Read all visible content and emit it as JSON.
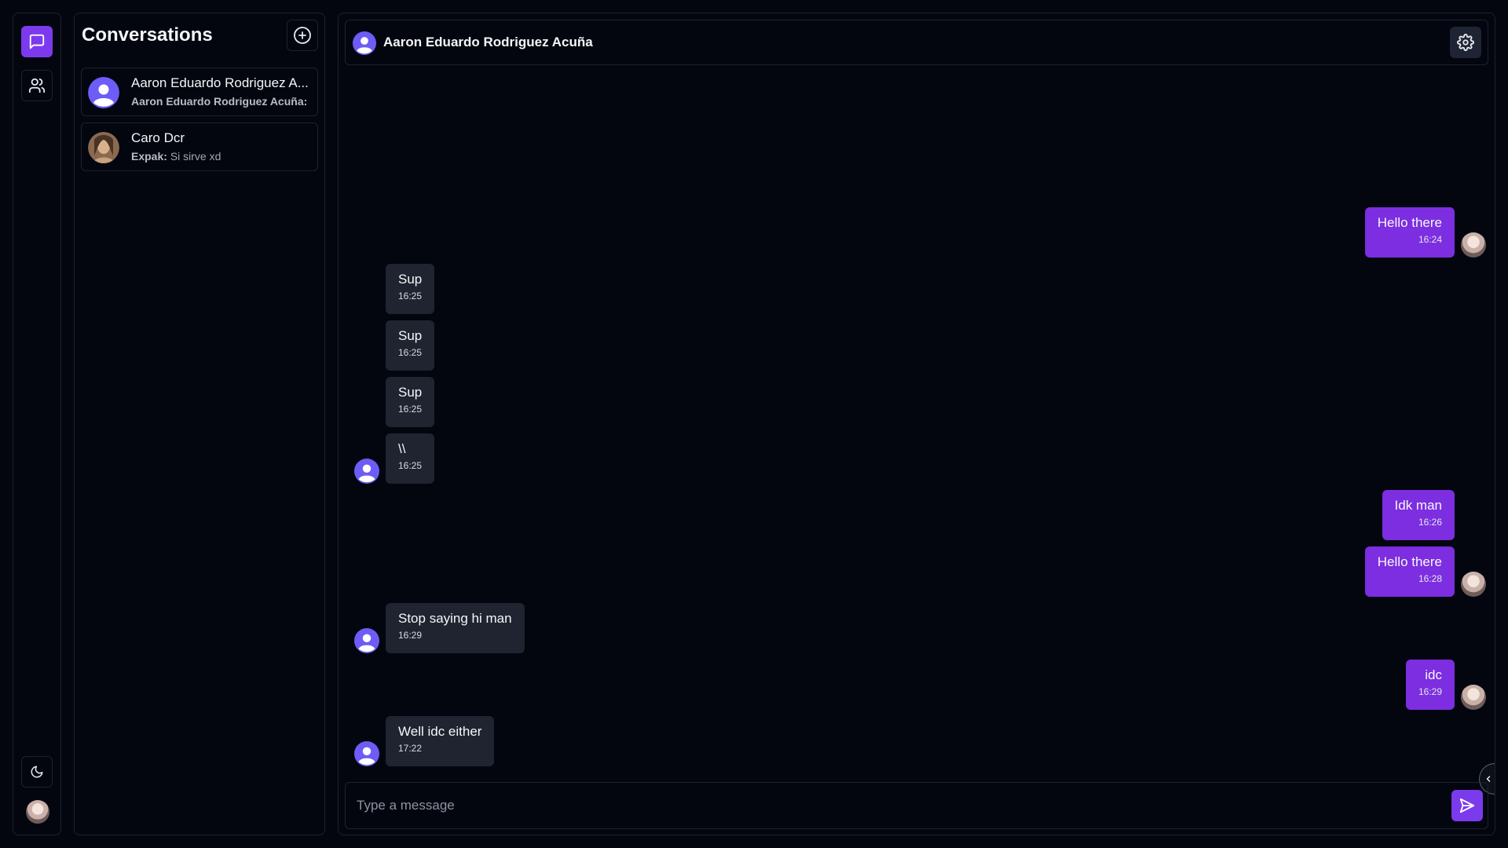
{
  "sidebar": {
    "chat_icon": "chat-bubble-icon",
    "contacts_icon": "users-icon",
    "theme_icon": "moon-icon"
  },
  "conversations": {
    "title": "Conversations",
    "add_icon": "plus-circle-icon",
    "items": [
      {
        "name": "Aaron Eduardo Rodriguez A...",
        "preview_sender": "Aaron Eduardo Rodriguez Acuña:",
        "preview_text": ""
      },
      {
        "name": "Caro Dcr",
        "preview_sender": "Expak:",
        "preview_text": "Si sirve xd"
      }
    ]
  },
  "chat": {
    "title": "Aaron Eduardo Rodriguez Acuña",
    "settings_icon": "gear-icon",
    "messages": [
      {
        "direction": "out",
        "text": "Hello there",
        "time": "16:24"
      },
      {
        "direction": "in",
        "text": "Sup",
        "time": "16:25"
      },
      {
        "direction": "in",
        "text": "Sup",
        "time": "16:25"
      },
      {
        "direction": "in",
        "text": "Sup",
        "time": "16:25"
      },
      {
        "direction": "in",
        "text": "\\\\",
        "time": "16:25"
      },
      {
        "direction": "out",
        "text": "Idk man",
        "time": "16:26"
      },
      {
        "direction": "out",
        "text": "Hello there",
        "time": "16:28"
      },
      {
        "direction": "in",
        "text": "Stop saying hi man",
        "time": "16:29"
      },
      {
        "direction": "out",
        "text": "idc",
        "time": "16:29"
      },
      {
        "direction": "in",
        "text": "Well idc either",
        "time": "17:22"
      }
    ],
    "composer": {
      "placeholder": "Type a message",
      "value": "",
      "send_icon": "send-icon"
    }
  },
  "colors": {
    "accent": "#7c3aed",
    "outgoing_bubble": "#7c2ee0",
    "incoming_bubble": "#1f2430",
    "background": "#03060f",
    "border": "#1d2230"
  }
}
